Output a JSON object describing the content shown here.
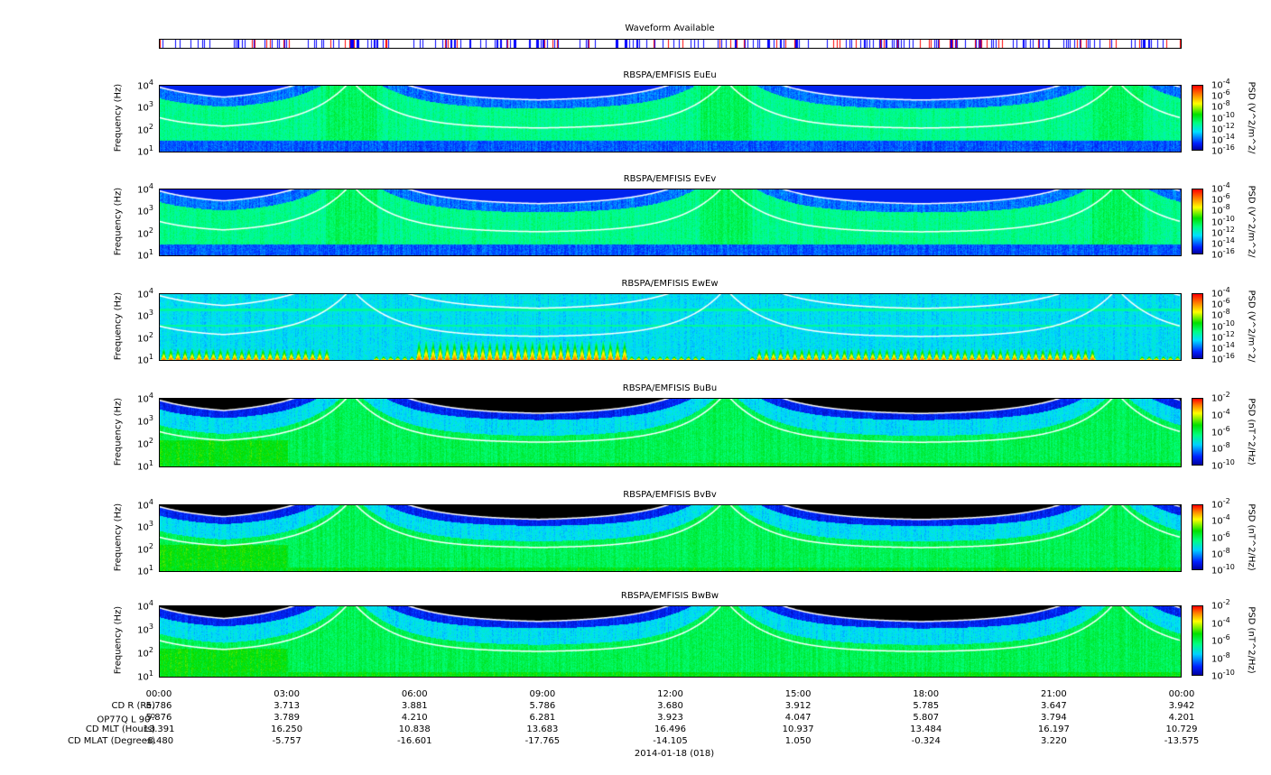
{
  "waveform": {
    "title": "Waveform Available"
  },
  "panels": [
    {
      "title": "RBSPA/EMFISIS  EuEu",
      "ylabel": "Frequency (Hz)",
      "type": "E",
      "cbar_label": "PSD (V^2/m^2/Hz)",
      "cbar_ticks": [
        "-4",
        "-6",
        "-8",
        "-10",
        "-12",
        "-14",
        "-16"
      ]
    },
    {
      "title": "RBSPA/EMFISIS  EvEv",
      "ylabel": "Frequency (Hz)",
      "type": "E",
      "cbar_label": "PSD (V^2/m^2/Hz)",
      "cbar_ticks": [
        "-4",
        "-6",
        "-8",
        "-10",
        "-12",
        "-14",
        "-16"
      ]
    },
    {
      "title": "RBSPA/EMFISIS  EwEw",
      "ylabel": "Frequency (Hz)",
      "type": "Ew",
      "cbar_label": "PSD (V^2/m^2/Hz)",
      "cbar_ticks": [
        "-4",
        "-6",
        "-8",
        "-10",
        "-12",
        "-14",
        "-16"
      ]
    },
    {
      "title": "RBSPA/EMFISIS  BuBu",
      "ylabel": "Frequency (Hz)",
      "type": "B",
      "cbar_label": "PSD (nT^2/Hz)",
      "cbar_ticks": [
        "-2",
        "-4",
        "-6",
        "-8",
        "-10"
      ]
    },
    {
      "title": "RBSPA/EMFISIS  BvBv",
      "ylabel": "Frequency (Hz)",
      "type": "B",
      "cbar_label": "PSD (nT^2/Hz)",
      "cbar_ticks": [
        "-2",
        "-4",
        "-6",
        "-8",
        "-10"
      ]
    },
    {
      "title": "RBSPA/EMFISIS  BwBw",
      "ylabel": "Frequency (Hz)",
      "type": "B",
      "cbar_label": "PSD (nT^2/Hz)",
      "cbar_ticks": [
        "-2",
        "-4",
        "-6",
        "-8",
        "-10"
      ]
    }
  ],
  "yticks": [
    "4",
    "3",
    "2",
    "1"
  ],
  "ytick_base": "10",
  "chart_data": {
    "type": "heatmap",
    "title": "RBSPA/EMFISIS spectrograms",
    "xlabel": "2014-01-18 (018)",
    "ylabel": "Frequency (Hz)",
    "ylim": [
      10,
      10000
    ],
    "yscale": "log",
    "x_ticks": [
      "00:00",
      "03:00",
      "06:00",
      "09:00",
      "12:00",
      "15:00",
      "18:00",
      "21:00",
      "00:00"
    ],
    "perigee_hours": [
      4.5,
      13.3,
      22.5
    ]
  },
  "ephemeris": {
    "date": "2014-01-18 (018)",
    "rows": [
      {
        "label": "CD R (Re)",
        "values": [
          "5.786",
          "3.713",
          "3.881",
          "5.786",
          "3.680",
          "3.912",
          "5.785",
          "3.647",
          "3.942"
        ]
      },
      {
        "label": "OP77Q L 90",
        "sup": "O",
        "values": [
          "5.876",
          "3.789",
          "4.210",
          "6.281",
          "3.923",
          "4.047",
          "5.807",
          "3.794",
          "4.201"
        ]
      },
      {
        "label": "CD MLT (Hours)",
        "values": [
          "13.391",
          "16.250",
          "10.838",
          "13.683",
          "16.496",
          "10.937",
          "13.484",
          "16.197",
          "10.729"
        ]
      },
      {
        "label": "CD MLAT (Degrees)",
        "values": [
          "-8.480",
          "-5.757",
          "-16.601",
          "-17.765",
          "-14.105",
          "1.050",
          "-0.324",
          "3.220",
          "-13.575"
        ]
      }
    ]
  },
  "colors": {
    "wf_blue": "#0000ff",
    "wf_red": "#ff0000"
  }
}
